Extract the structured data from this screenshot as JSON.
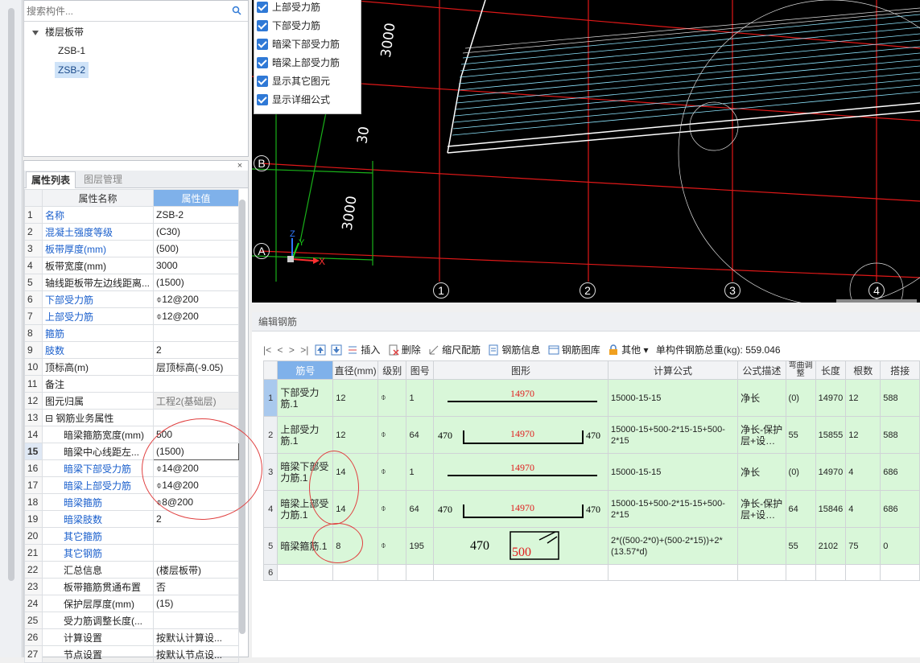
{
  "search": {
    "placeholder": "搜索构件..."
  },
  "tree": {
    "root": "楼层板带",
    "items": [
      "ZSB-1",
      "ZSB-2"
    ],
    "selected_index": 1
  },
  "prop_panel": {
    "tabs": [
      "属性列表",
      "图层管理"
    ],
    "col_name": "属性名称",
    "col_value": "属性值",
    "rows": [
      {
        "n": "1",
        "name": "名称",
        "value": "ZSB-2",
        "blue": true
      },
      {
        "n": "2",
        "name": "混凝土强度等级",
        "value": "(C30)",
        "blue": true
      },
      {
        "n": "3",
        "name": "板带厚度(mm)",
        "value": "(500)",
        "blue": true
      },
      {
        "n": "4",
        "name": "板带宽度(mm)",
        "value": "3000",
        "blue": false
      },
      {
        "n": "5",
        "name": "轴线距板带左边线距离...",
        "value": "(1500)",
        "blue": false
      },
      {
        "n": "6",
        "name": "下部受力筋",
        "value": "⌽12@200",
        "blue": true
      },
      {
        "n": "7",
        "name": "上部受力筋",
        "value": "⌽12@200",
        "blue": true
      },
      {
        "n": "8",
        "name": "箍筋",
        "value": "",
        "blue": true
      },
      {
        "n": "9",
        "name": "肢数",
        "value": "2",
        "blue": true
      },
      {
        "n": "10",
        "name": "顶标高(m)",
        "value": "层顶标高(-9.05)",
        "blue": false
      },
      {
        "n": "11",
        "name": "备注",
        "value": "",
        "blue": false
      },
      {
        "n": "12",
        "name": "图元归属",
        "value": "工程2(基础层)",
        "blue": false,
        "gray": true
      },
      {
        "n": "13",
        "name": "⊟ 钢筋业务属性",
        "value": "",
        "blue": false
      },
      {
        "n": "14",
        "name": "暗梁箍筋宽度(mm)",
        "value": "500",
        "blue": false,
        "indent": true
      },
      {
        "n": "15",
        "name": "暗梁中心线距左...",
        "value": "(1500)",
        "blue": false,
        "indent": true,
        "current": true
      },
      {
        "n": "16",
        "name": "暗梁下部受力筋",
        "value": "⌽14@200",
        "blue": true,
        "indent": true
      },
      {
        "n": "17",
        "name": "暗梁上部受力筋",
        "value": "⌽14@200",
        "blue": true,
        "indent": true
      },
      {
        "n": "18",
        "name": "暗梁箍筋",
        "value": "⌽8@200",
        "blue": true,
        "indent": true
      },
      {
        "n": "19",
        "name": "暗梁肢数",
        "value": "2",
        "blue": true,
        "indent": true
      },
      {
        "n": "20",
        "name": "其它箍筋",
        "value": "",
        "blue": true,
        "indent": true
      },
      {
        "n": "21",
        "name": "其它钢筋",
        "value": "",
        "blue": true,
        "indent": true
      },
      {
        "n": "22",
        "name": "汇总信息",
        "value": "(楼层板带)",
        "blue": false,
        "indent": true
      },
      {
        "n": "23",
        "name": "板带箍筋贯通布置",
        "value": "否",
        "blue": false,
        "indent": true
      },
      {
        "n": "24",
        "name": "保护层厚度(mm)",
        "value": "(15)",
        "blue": false,
        "indent": true
      },
      {
        "n": "25",
        "name": "受力筋调整长度(...",
        "value": "",
        "blue": false,
        "indent": true
      },
      {
        "n": "26",
        "name": "计算设置",
        "value": "按默认计算设...",
        "blue": false,
        "indent": true
      },
      {
        "n": "27",
        "name": "节点设置",
        "value": "按默认节点设...",
        "blue": false,
        "indent": true
      }
    ]
  },
  "checkbox_menu": {
    "items": [
      "上部受力筋",
      "下部受力筋",
      "暗梁下部受力筋",
      "暗梁上部受力筋",
      "显示其它图元",
      "显示详细公式"
    ]
  },
  "viewport": {
    "dim_labels": [
      "3000",
      "30",
      "3000"
    ],
    "axis_rows": [
      "B",
      "A"
    ],
    "axis_cols": [
      "1",
      "2",
      "3",
      "4"
    ],
    "axes": {
      "x": "X",
      "y": "Y",
      "z": "Z"
    },
    "colors": {
      "grid": "#e01818",
      "green": "#19b019",
      "bg": "#000000"
    }
  },
  "rebar": {
    "header": "编辑钢筋",
    "toolbar": {
      "nav": [
        "|<",
        "<",
        ">",
        ">|"
      ],
      "insert": "插入",
      "delete": "删除",
      "scale": "缩尺配筋",
      "info": "钢筋信息",
      "library": "钢筋图库",
      "other": "其他",
      "total_label": "单构件钢筋总重(kg): 559.046"
    },
    "columns": [
      "筋号",
      "直径(mm)",
      "级别",
      "图号",
      "图形",
      "计算公式",
      "公式描述",
      "弯曲调整",
      "长度",
      "根数",
      "搭接"
    ],
    "rows": [
      {
        "n": "1",
        "name": "下部受力筋.1",
        "dia": "12",
        "grade": "⌽",
        "fig": "1",
        "shape": "straight",
        "dim": "14970",
        "left": "",
        "right": "",
        "formula": "15000-15-15",
        "desc": "净长",
        "bend": "(0)",
        "len": "14970",
        "count": "12",
        "lap": "588"
      },
      {
        "n": "2",
        "name": "上部受力筋.1",
        "dia": "12",
        "grade": "⌽",
        "fig": "64",
        "shape": "u",
        "dim": "14970",
        "left": "470",
        "right": "470",
        "formula": "15000-15+500-2*15-15+500-2*15",
        "desc": "净长-保护层+设…",
        "bend": "55",
        "len": "15855",
        "count": "12",
        "lap": "588"
      },
      {
        "n": "3",
        "name": "暗梁下部受力筋.1",
        "dia": "14",
        "grade": "⌽",
        "fig": "1",
        "shape": "straight",
        "dim": "14970",
        "left": "",
        "right": "",
        "formula": "15000-15-15",
        "desc": "净长",
        "bend": "(0)",
        "len": "14970",
        "count": "4",
        "lap": "686"
      },
      {
        "n": "4",
        "name": "暗梁上部受力筋.1",
        "dia": "14",
        "grade": "⌽",
        "fig": "64",
        "shape": "u",
        "dim": "14970",
        "left": "470",
        "right": "470",
        "formula": "15000-15+500-2*15-15+500-2*15",
        "desc": "净长-保护层+设…",
        "bend": "64",
        "len": "15846",
        "count": "4",
        "lap": "686"
      },
      {
        "n": "5",
        "name": "暗梁箍筋.1",
        "dia": "8",
        "grade": "⌽",
        "fig": "195",
        "shape": "stirrup",
        "dim": "500",
        "left": "470",
        "right": "",
        "formula": "2*((500-2*0)+(500-2*15))+2*(13.57*d)",
        "desc": "",
        "bend": "55",
        "len": "2102",
        "count": "75",
        "lap": "0"
      },
      {
        "n": "6",
        "name": "",
        "dia": "",
        "grade": "",
        "fig": "",
        "shape": "",
        "dim": "",
        "left": "",
        "right": "",
        "formula": "",
        "desc": "",
        "bend": "",
        "len": "",
        "count": "",
        "lap": ""
      }
    ]
  }
}
